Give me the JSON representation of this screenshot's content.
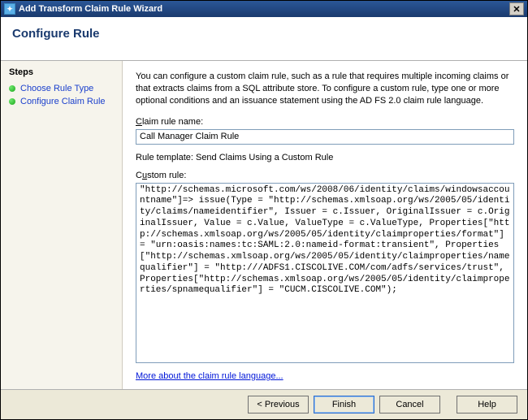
{
  "titlebar": {
    "title": "Add Transform Claim Rule Wizard"
  },
  "header": {
    "title": "Configure Rule"
  },
  "sidebar": {
    "steps_label": "Steps",
    "items": [
      {
        "label": "Choose Rule Type"
      },
      {
        "label": "Configure Claim Rule"
      }
    ]
  },
  "main": {
    "description": "You can configure a custom claim rule, such as a rule that requires multiple incoming claims or that extracts claims from a SQL attribute store. To configure a custom rule, type one or more optional conditions and an issuance statement using the AD FS 2.0 claim rule language.",
    "rule_name_label": "Claim rule name:",
    "rule_name_value": "Call Manager Claim Rule",
    "template_label": "Rule template: Send Claims Using a Custom Rule",
    "custom_rule_label": "Custom rule:",
    "custom_rule_value": "\"http://schemas.microsoft.com/ws/2008/06/identity/claims/windowsaccountname\"]=> issue(Type = \"http://schemas.xmlsoap.org/ws/2005/05/identity/claims/nameidentifier\", Issuer = c.Issuer, OriginalIssuer = c.OriginalIssuer, Value = c.Value, ValueType = c.ValueType, Properties[\"http://schemas.xmlsoap.org/ws/2005/05/identity/claimproperties/format\"] = \"urn:oasis:names:tc:SAML:2.0:nameid-format:transient\", Properties[\"http://schemas.xmlsoap.org/ws/2005/05/identity/claimproperties/namequalifier\"] = \"http:///ADFS1.CISCOLIVE.COM/com/adfs/services/trust\", Properties[\"http://schemas.xmlsoap.org/ws/2005/05/identity/claimproperties/spnamequalifier\"] = \"CUCM.CISCOLIVE.COM\");",
    "link_text": "More about the claim rule language..."
  },
  "footer": {
    "previous": "< Previous",
    "finish": "Finish",
    "cancel": "Cancel",
    "help": "Help"
  }
}
